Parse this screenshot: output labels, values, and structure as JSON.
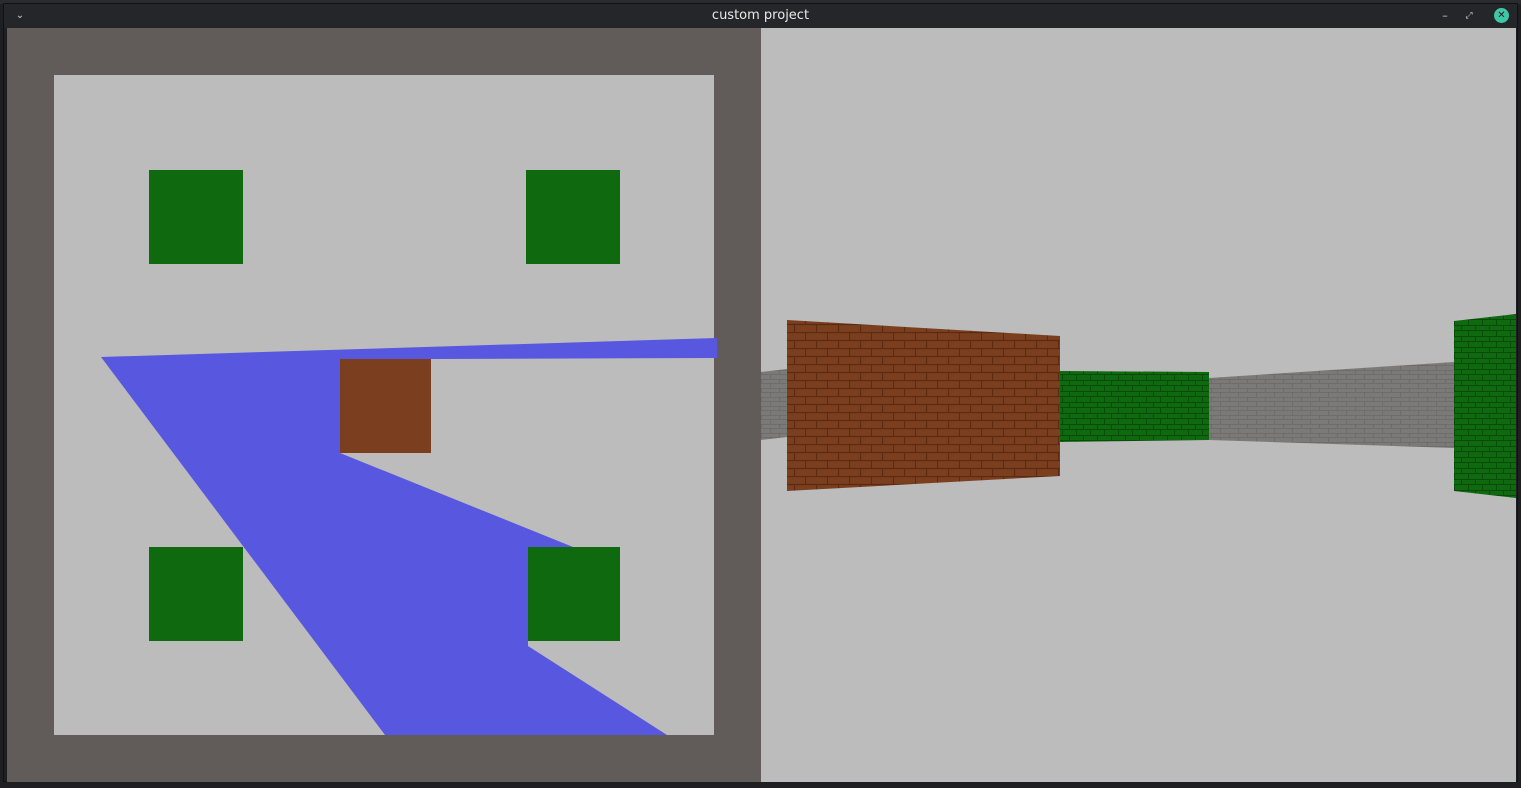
{
  "window": {
    "title": "custom project",
    "menu_glyph": "⌄",
    "minimize_glyph": "–",
    "maximize_glyph": "⤢",
    "close_glyph": "✕"
  },
  "colors": {
    "wall_frame": "#615c5a",
    "floor": "#bcbcbc",
    "green_block": "#0f6a0f",
    "brick_block": "#7b3f1f",
    "fov_rays": "#5757df",
    "stone_wall": "#7c7a78"
  },
  "icons": {
    "menu": "chevron-down-icon",
    "minimize": "minimize-icon",
    "maximize": "maximize-icon",
    "close": "close-icon"
  }
}
